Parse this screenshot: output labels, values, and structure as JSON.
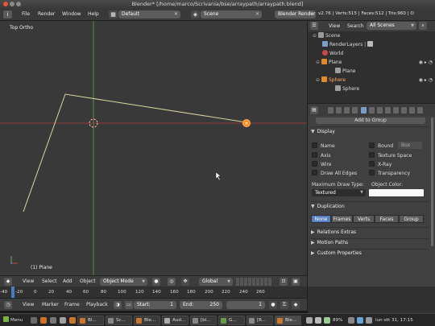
{
  "window": {
    "title": "Blender* [/home/marco/Scrivania/bse/arraypath/arraypath.blend]"
  },
  "header": {
    "menus": [
      "File",
      "Render",
      "Window",
      "Help"
    ],
    "screen_layout": "Default",
    "scene": "Scene",
    "render_engine": "Blender Render",
    "stats": "v2.76 | Verts:515 | Faces:512 | Tris:960 | O"
  },
  "viewport": {
    "view_label": "Top Ortho",
    "active_object": "(1) Plane",
    "header_menus": [
      "View",
      "Select",
      "Add",
      "Object"
    ],
    "mode": "Object Mode",
    "orientation": "Global"
  },
  "timeline": {
    "ticks": [
      "-40",
      "-20",
      "0",
      "20",
      "40",
      "60",
      "80",
      "100",
      "120",
      "140",
      "160",
      "180",
      "200",
      "220",
      "240",
      "260"
    ],
    "menus": [
      "View",
      "Marker",
      "Frame",
      "Playback"
    ],
    "start_label": "Start:",
    "start_value": "1",
    "end_label": "End:",
    "end_value": "250",
    "current_frame": "1"
  },
  "outliner": {
    "menus": [
      "View",
      "Search"
    ],
    "filter": "All Scenes",
    "items": [
      {
        "label": "Scene",
        "indent": 0
      },
      {
        "label": "RenderLayers",
        "indent": 1
      },
      {
        "label": "World",
        "indent": 1
      },
      {
        "label": "Plane",
        "indent": 1
      },
      {
        "label": "Plane",
        "indent": 2
      },
      {
        "label": "Sphere",
        "indent": 1
      },
      {
        "label": "Sphere",
        "indent": 2
      }
    ]
  },
  "properties": {
    "add_to_group": "Add to Group",
    "display": {
      "title": "Display",
      "checks": [
        "Name",
        "Axis",
        "Wire",
        "Draw All Edges",
        "Bound",
        "Texture Space",
        "X-Ray",
        "Transparency"
      ],
      "bound_type": "Box",
      "max_draw_label": "Maximum Draw Type:",
      "max_draw_value": "Textured",
      "object_color_label": "Object Color:"
    },
    "duplication": {
      "title": "Duplication",
      "tabs": [
        "None",
        "Frames",
        "Verts",
        "Faces",
        "Group"
      ],
      "active_tab": "None"
    },
    "collapsed_panels": [
      "Relations Extras",
      "Motion Paths",
      "Custom Properties"
    ]
  },
  "taskbar": {
    "menu_label": "Menu",
    "windows": [
      "Bl...",
      "Sc...",
      "Ble...",
      "Aud...",
      "[bl...",
      "G...",
      "[R...",
      "Ble..."
    ],
    "battery": "89%",
    "clock": "lun ott 31, 17:15"
  },
  "colors": {
    "viewport_bg": "#393939",
    "x_axis": "#8f3a3a",
    "y_axis": "#5a8f3a",
    "path_line": "#d9d4a0",
    "selected_object": "#ff8a1a",
    "active_tab": "#5680c2"
  }
}
